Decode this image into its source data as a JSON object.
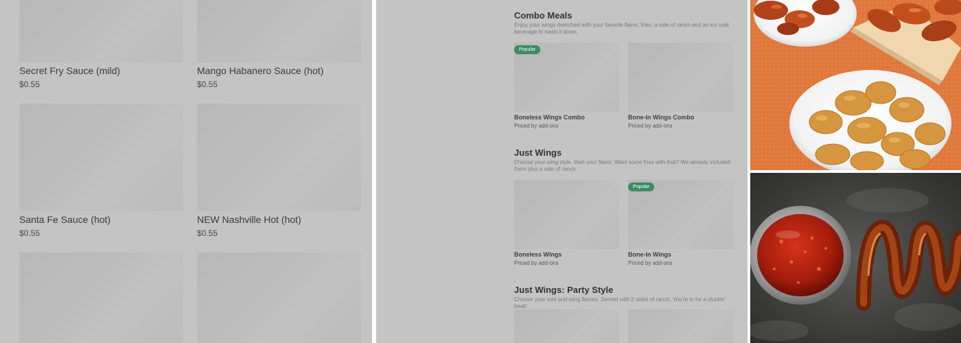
{
  "left_items": [
    {
      "name": "Secret Fry Sauce (mild)",
      "price": "$0.55"
    },
    {
      "name": "Mango Habanero Sauce (hot)",
      "price": "$0.55"
    },
    {
      "name": "Santa Fe Sauce (hot)",
      "price": "$0.55"
    },
    {
      "name": "NEW Nashville Hot (hot)",
      "price": "$0.55"
    }
  ],
  "sections": [
    {
      "title": "Combo Meals",
      "description": "Enjoy your wings drenched with your favorite flavor, fries, a side of ranch and an ice cold beverage to wash it down.",
      "items": [
        {
          "name": "Boneless Wings Combo",
          "price": "Priced by add-ons",
          "badge": "Popular"
        },
        {
          "name": "Bone-In Wings Combo",
          "price": "Priced by add-ons"
        }
      ]
    },
    {
      "title": "Just Wings",
      "description": "Choose your wing style, then your flavor. Want some fries with that? We already included them plus a side of ranch.",
      "items": [
        {
          "name": "Boneless Wings",
          "price": "Priced by add-ons"
        },
        {
          "name": "Bone-In Wings",
          "price": "Priced by add-ons",
          "badge": "Popular"
        }
      ]
    },
    {
      "title": "Just Wings: Party Style",
      "description": "Choose your size and wing flavors. Served with 2 sides of ranch. You're in for a cluckin' treat!"
    }
  ],
  "colors": {
    "placeholder_bg": "#c4c4c4",
    "badge": "#3d8a63",
    "orange_surface": "#e07a3f",
    "slate_surface": "#3e3e3e"
  }
}
